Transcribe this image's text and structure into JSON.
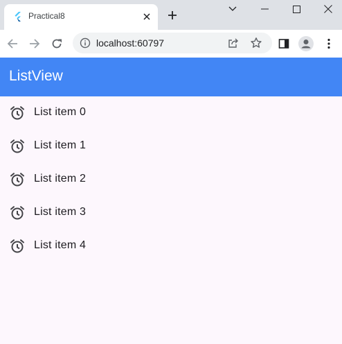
{
  "browser": {
    "tab": {
      "title": "Practical8",
      "favicon": "flutter-logo-icon"
    },
    "window_controls": [
      "chevron-down-icon",
      "minimize-icon",
      "maximize-icon",
      "close-icon"
    ],
    "toolbar": {
      "url": "localhost:60797",
      "icons": [
        "back-arrow-icon",
        "forward-arrow-icon",
        "reload-icon",
        "info-icon",
        "share-icon",
        "star-icon",
        "sidebar-icon",
        "profile-icon",
        "more-vert-icon"
      ]
    }
  },
  "app": {
    "title": "ListView",
    "primary_color": "#4286f5",
    "background_color": "#fdf7fd",
    "list": {
      "icon": "alarm-icon",
      "items": [
        {
          "label": "List item 0"
        },
        {
          "label": "List item 1"
        },
        {
          "label": "List item 2"
        },
        {
          "label": "List item 3"
        },
        {
          "label": "List item 4"
        }
      ]
    }
  }
}
